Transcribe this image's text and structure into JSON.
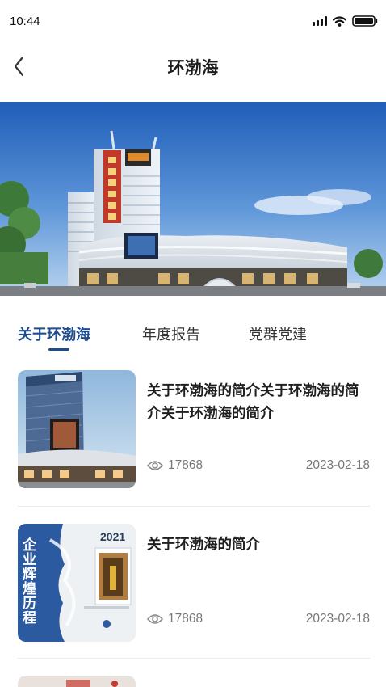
{
  "status": {
    "time": "10:44"
  },
  "header": {
    "title": "环渤海"
  },
  "tabs": [
    {
      "label": "关于环渤海",
      "active": true
    },
    {
      "label": "年度报告",
      "active": false
    },
    {
      "label": "党群党建",
      "active": false
    }
  ],
  "articles": [
    {
      "title": "关于环渤海的简介关于环渤海的简介关于环渤海的简介",
      "views": "17868",
      "date": "2023-02-18"
    },
    {
      "title": "关于环渤海的简介",
      "views": "17868",
      "date": "2023-02-18"
    }
  ],
  "thumb2": {
    "year": "2021",
    "vertical_text": "企业辉煌历程"
  },
  "colors": {
    "accent": "#1e4d8f",
    "text": "#1f1f1f",
    "meta": "#777777"
  }
}
